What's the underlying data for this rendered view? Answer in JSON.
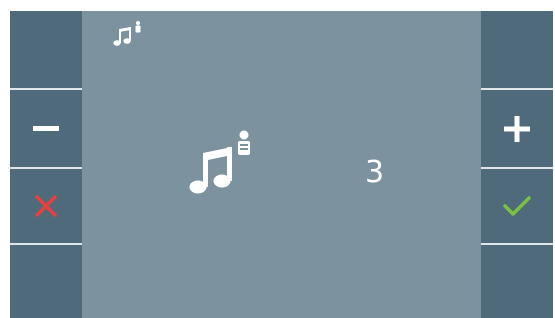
{
  "ringtone_level": {
    "value": "3"
  },
  "buttons": {
    "decrease": {
      "icon": "minus-icon"
    },
    "increase": {
      "icon": "plus-icon"
    },
    "cancel": {
      "icon": "close-icon",
      "color": "#e8403a"
    },
    "confirm": {
      "icon": "check-icon",
      "color": "#7ac143"
    }
  },
  "indicators": {
    "status_icon": "music-note-person-icon",
    "main_icon": "music-note-person-icon"
  },
  "colors": {
    "screen_bg": "#7c929f",
    "side_panel_bg": "#4e6a7b",
    "text": "#ffffff"
  }
}
